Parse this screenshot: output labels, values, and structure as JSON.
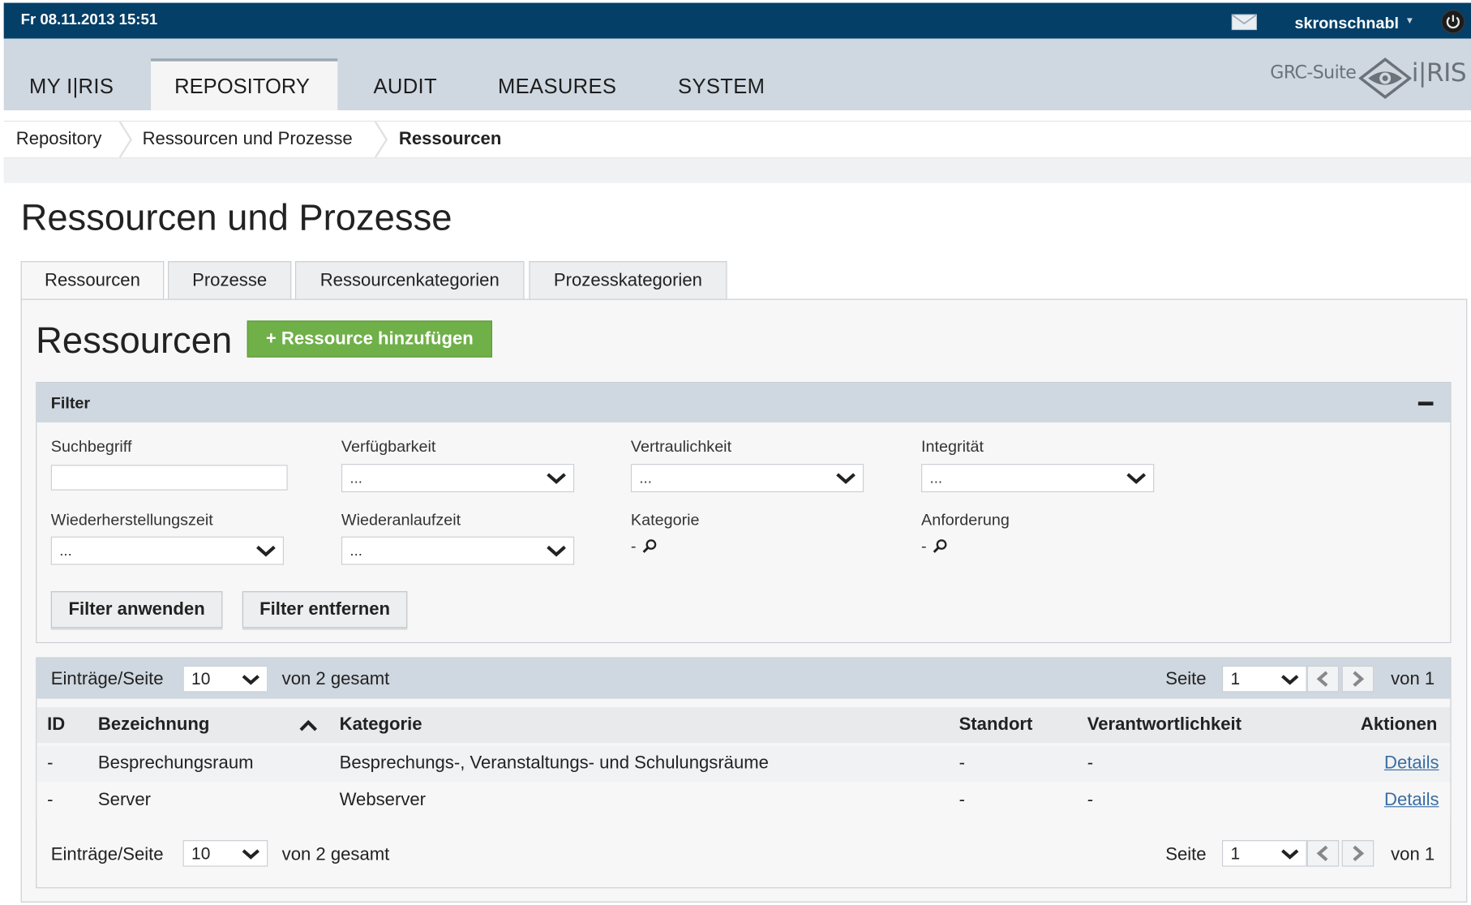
{
  "topbar": {
    "datetime": "Fr 08.11.2013 15:51",
    "username": "skronschnabl"
  },
  "nav": {
    "items": [
      "MY I|RIS",
      "REPOSITORY",
      "AUDIT",
      "MEASURES",
      "SYSTEM"
    ],
    "active": "REPOSITORY"
  },
  "logo": {
    "suite": "GRC-Suite",
    "brand": "i|RIS"
  },
  "breadcrumb": [
    "Repository",
    "Ressourcen und Prozesse",
    "Ressourcen"
  ],
  "page": {
    "title": "Ressourcen und Prozesse"
  },
  "tabs": [
    "Ressourcen",
    "Prozesse",
    "Ressourcenkategorien",
    "Prozesskategorien"
  ],
  "section": {
    "title": "Ressourcen",
    "add_button": "+ Ressource hinzufügen"
  },
  "filter": {
    "title": "Filter",
    "fields": {
      "suchbegriff": {
        "label": "Suchbegriff",
        "value": ""
      },
      "verfuegbarkeit": {
        "label": "Verfügbarkeit",
        "value": "..."
      },
      "vertraulichkeit": {
        "label": "Vertraulichkeit",
        "value": "..."
      },
      "integritaet": {
        "label": "Integrität",
        "value": "..."
      },
      "wiederherstellungszeit": {
        "label": "Wiederherstellungszeit",
        "value": "..."
      },
      "wiederanlaufzeit": {
        "label": "Wiederanlaufzeit",
        "value": "..."
      },
      "kategorie": {
        "label": "Kategorie",
        "value": "-"
      },
      "anforderung": {
        "label": "Anforderung",
        "value": "-"
      }
    },
    "apply": "Filter anwenden",
    "remove": "Filter entfernen"
  },
  "pager": {
    "entries_label": "Einträge/Seite",
    "entries_value": "10",
    "total": "von 2 gesamt",
    "page_label": "Seite",
    "page_value": "1",
    "of_pages": "von 1"
  },
  "table": {
    "columns": [
      "ID",
      "Bezeichnung",
      "Kategorie",
      "Standort",
      "Verantwortlichkeit",
      "Aktionen"
    ],
    "rows": [
      {
        "id": "-",
        "name": "Besprechungsraum",
        "category": "Besprechungs-, Veranstaltungs- und Schulungsräume",
        "location": "-",
        "responsibility": "-",
        "action": "Details"
      },
      {
        "id": "-",
        "name": "Server",
        "category": "Webserver",
        "location": "-",
        "responsibility": "-",
        "action": "Details"
      }
    ]
  },
  "colors": {
    "topbar": "#043f68",
    "nav": "#cfd7e0",
    "accent_green": "#6fb048",
    "link": "#3a6ea5"
  }
}
